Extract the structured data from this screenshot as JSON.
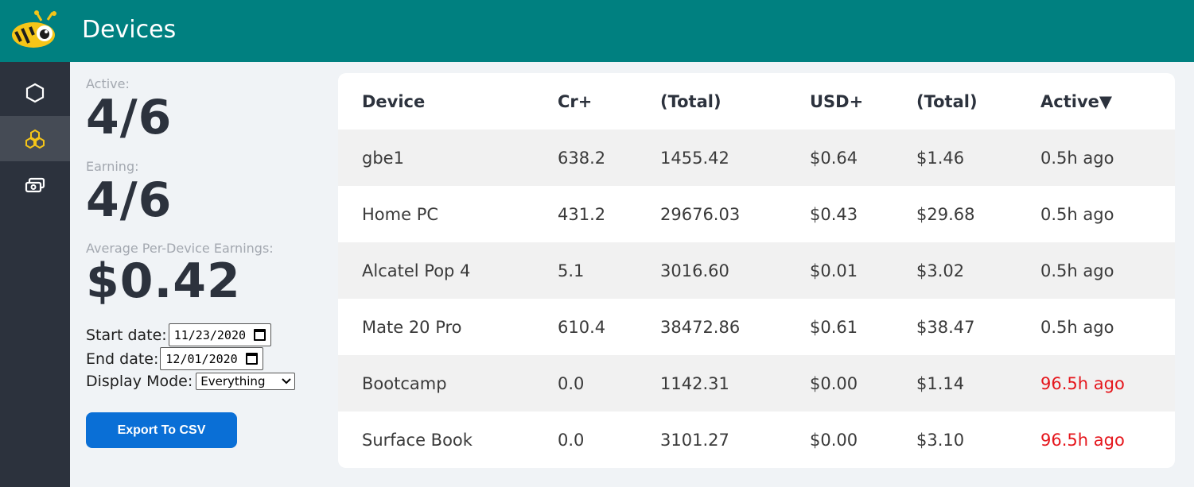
{
  "header": {
    "title": "Devices"
  },
  "sidebar": {
    "items": [
      {
        "icon": "hexagon-icon",
        "active": false
      },
      {
        "icon": "honeycomb-icon",
        "active": true
      },
      {
        "icon": "money-icon",
        "active": false
      }
    ]
  },
  "stats": {
    "active_label": "Active:",
    "active_value": "4/6",
    "earning_label": "Earning:",
    "earning_value": "4/6",
    "avg_label": "Average Per-Device Earnings:",
    "avg_value": "$0.42"
  },
  "filters": {
    "start_label": "Start date:",
    "start_value": "11/23/2020",
    "end_label": "End date:",
    "end_value": "12/01/2020",
    "mode_label": "Display Mode:",
    "mode_value": "Everything"
  },
  "export_label": "Export To CSV",
  "table": {
    "headers": [
      "Device",
      "Cr+",
      "(Total)",
      "USD+",
      "(Total)",
      "Active▼"
    ],
    "rows": [
      [
        "gbe1",
        "638.2",
        "1455.42",
        "$0.64",
        "$1.46",
        "0.5h ago"
      ],
      [
        "Home PC",
        "431.2",
        "29676.03",
        "$0.43",
        "$29.68",
        "0.5h ago"
      ],
      [
        "Alcatel Pop 4",
        "5.1",
        "3016.60",
        "$0.01",
        "$3.02",
        "0.5h ago"
      ],
      [
        "Mate 20 Pro",
        "610.4",
        "38472.86",
        "$0.61",
        "$38.47",
        "0.5h ago"
      ],
      [
        "Bootcamp",
        "0.0",
        "1142.31",
        "$0.00",
        "$1.14",
        "96.5h ago"
      ],
      [
        "Surface Book",
        "0.0",
        "3101.27",
        "$0.00",
        "$3.10",
        "96.5h ago"
      ]
    ]
  },
  "colors": {
    "header_bg": "#008080",
    "sidebar_bg": "#2c323d",
    "stale": "#e5161c",
    "button": "#0a6fd6"
  }
}
